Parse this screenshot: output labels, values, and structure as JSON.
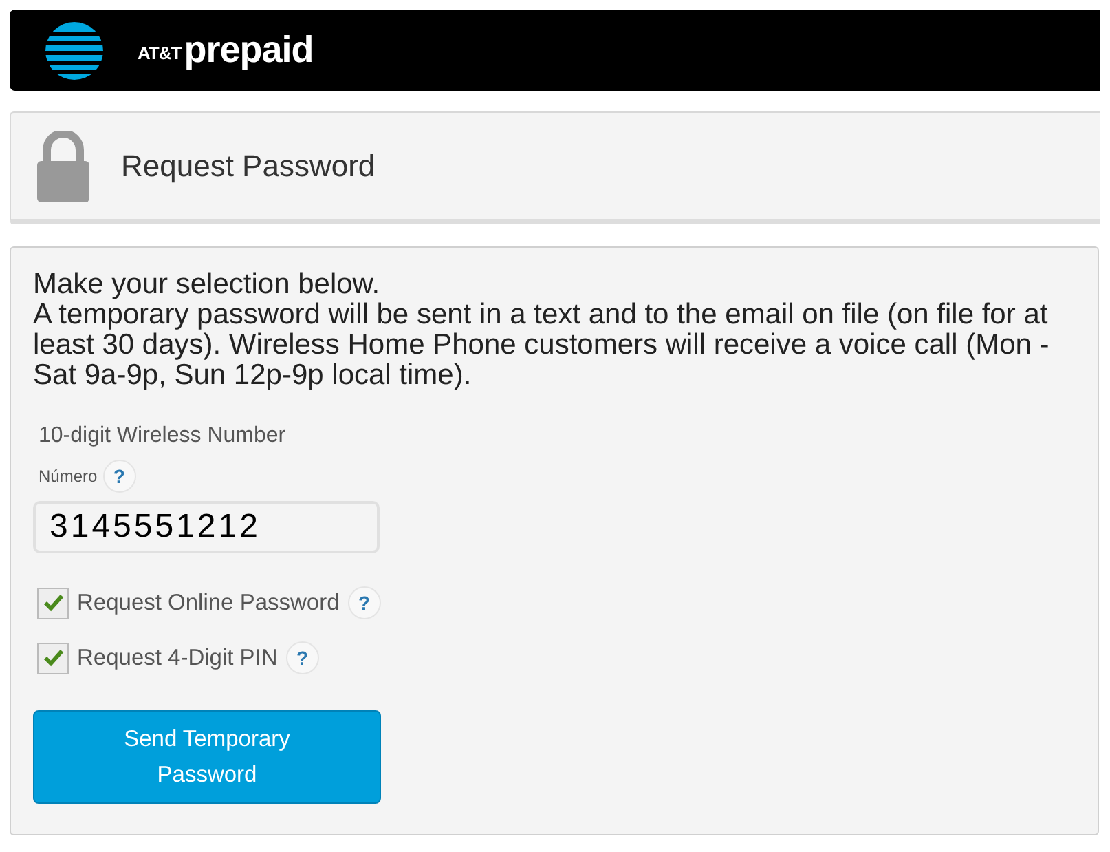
{
  "header": {
    "brand": "AT&T",
    "product": "prepaid"
  },
  "title_panel": {
    "title": "Request Password"
  },
  "form": {
    "intro": "Make your selection below.",
    "description": "A temporary password will be sent in a text and to the email on file (on file for at least 30 days). Wireless Home Phone customers will receive a voice call (Mon - Sat 9a-9p, Sun 12p-9p local time).",
    "number_label": "10-digit Wireless Number",
    "sub_label": "Número",
    "sub_help": "?",
    "number_value": "3145551212",
    "options": [
      {
        "label": "Request Online Password",
        "checked": true,
        "help": "?"
      },
      {
        "label": "Request 4-Digit PIN",
        "checked": true,
        "help": "?"
      }
    ],
    "submit": "Send Temporary Password"
  }
}
